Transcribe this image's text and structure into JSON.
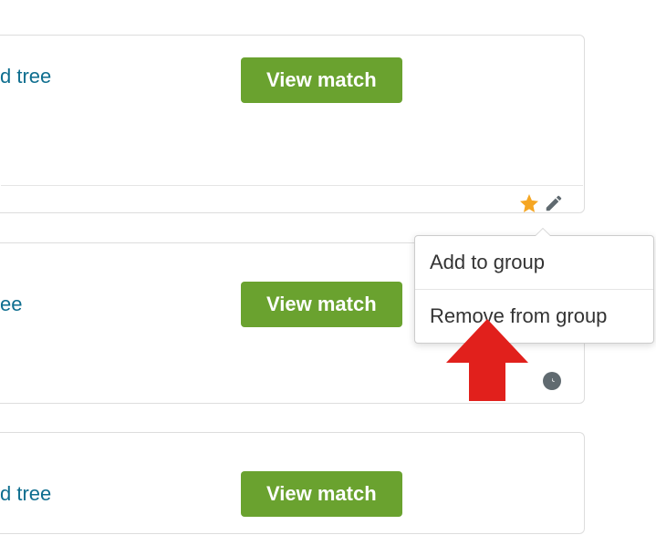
{
  "cards": [
    {
      "link_text": "d tree",
      "button_label": "View match"
    },
    {
      "link_text": "ee",
      "button_label": "View match"
    },
    {
      "link_text": "d tree",
      "button_label": "View match"
    }
  ],
  "actions": {
    "star": "star-icon",
    "edit": "pencil-icon"
  },
  "menu": {
    "add": "Add to group",
    "remove": "Remove from group"
  }
}
